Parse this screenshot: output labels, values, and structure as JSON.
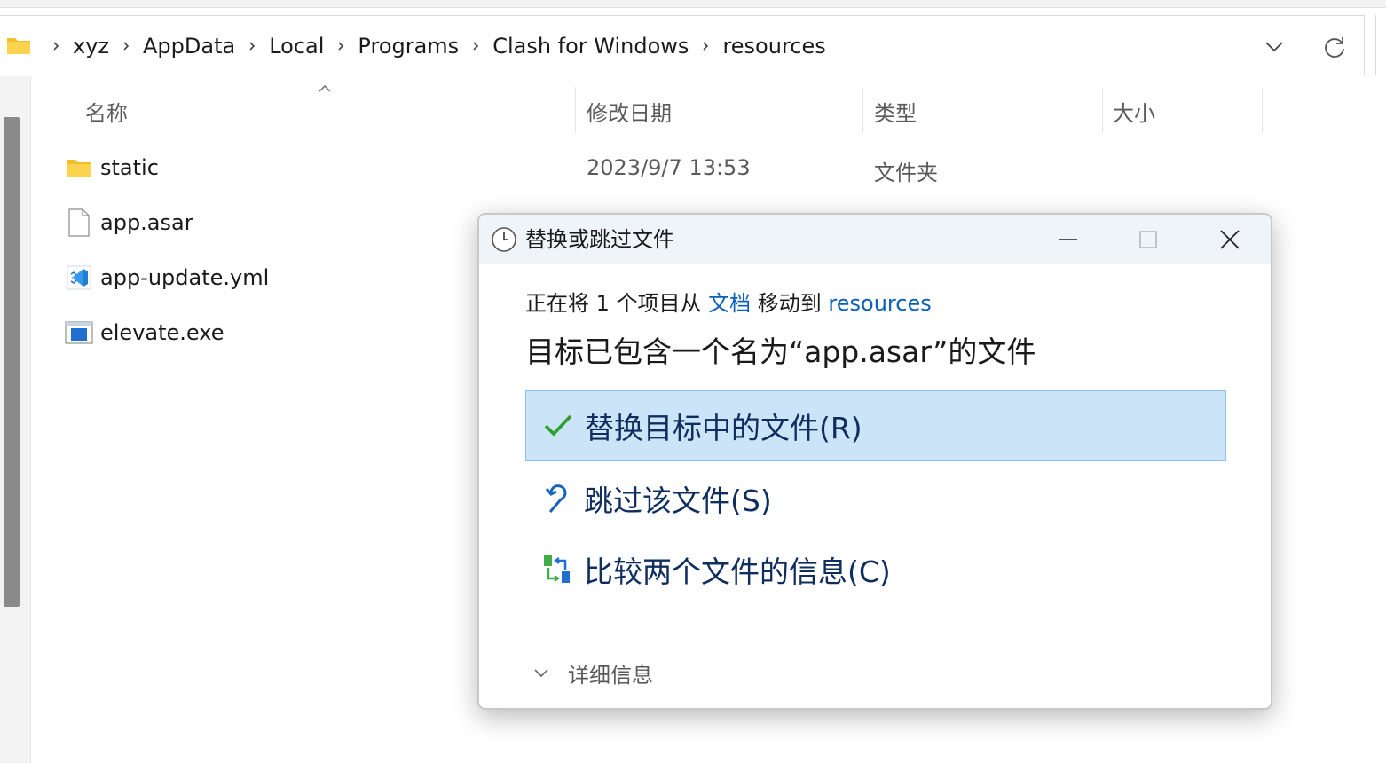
{
  "address_bar": {
    "crumbs": [
      "xyz",
      "AppData",
      "Local",
      "Programs",
      "Clash for Windows",
      "resources"
    ]
  },
  "columns": {
    "name": "名称",
    "modified": "修改日期",
    "type": "类型",
    "size": "大小"
  },
  "files": [
    {
      "name": "static",
      "modified": "2023/9/7 13:53",
      "type": "文件夹",
      "icon": "folder-icon"
    },
    {
      "name": "app.asar",
      "modified": "",
      "type": "",
      "icon": "file-icon"
    },
    {
      "name": "app-update.yml",
      "modified": "",
      "type": "",
      "icon": "vscode-file-icon"
    },
    {
      "name": "elevate.exe",
      "modified": "",
      "type": "",
      "icon": "exe-icon"
    }
  ],
  "dialog": {
    "title": "替换或跳过文件",
    "subline_prefix": "正在将 1 个项目从 ",
    "source": "文档",
    "subline_middle": " 移动到 ",
    "destination": "resources",
    "headline": "目标已包含一个名为“app.asar”的文件",
    "options": [
      {
        "label": "替换目标中的文件(R)",
        "icon": "checkmark-icon",
        "selected": true
      },
      {
        "label": "跳过该文件(S)",
        "icon": "skip-arrow-icon",
        "selected": false
      },
      {
        "label": "比较两个文件的信息(C)",
        "icon": "compare-icon",
        "selected": false
      }
    ],
    "details_label": "详细信息"
  },
  "colors": {
    "accent_link": "#0a5fb8",
    "selected_option_bg": "#cce4f7",
    "option_text": "#0f2d5e",
    "title_bar_bg": "#eff4f9"
  }
}
